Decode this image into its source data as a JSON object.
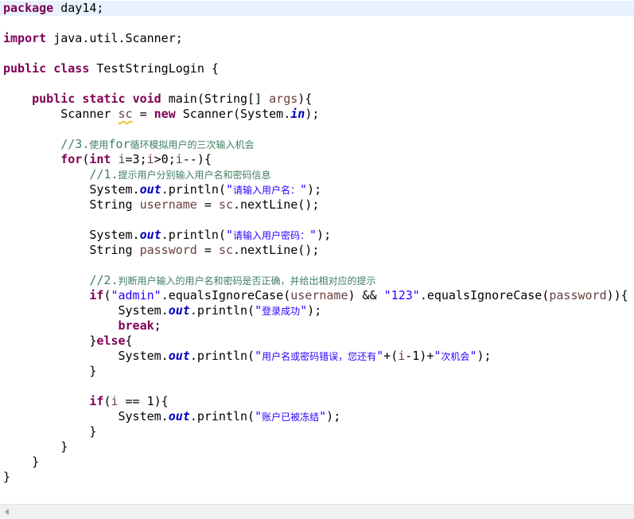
{
  "editor": {
    "lines": [
      {
        "tokens": [
          {
            "t": "package",
            "c": "kw"
          },
          {
            "t": " day14;"
          }
        ]
      },
      {
        "tokens": []
      },
      {
        "tokens": [
          {
            "t": "import",
            "c": "kw"
          },
          {
            "t": " java.util.Scanner;"
          }
        ]
      },
      {
        "tokens": []
      },
      {
        "tokens": [
          {
            "t": "public",
            "c": "kw"
          },
          {
            "t": " "
          },
          {
            "t": "class",
            "c": "kw"
          },
          {
            "t": " TestStringLogin {"
          }
        ]
      },
      {
        "tokens": []
      },
      {
        "tokens": [
          {
            "t": "    "
          },
          {
            "t": "public",
            "c": "kw"
          },
          {
            "t": " "
          },
          {
            "t": "static",
            "c": "kw"
          },
          {
            "t": " "
          },
          {
            "t": "void",
            "c": "kw"
          },
          {
            "t": " main(String[] "
          },
          {
            "t": "args",
            "c": "var"
          },
          {
            "t": "){"
          }
        ]
      },
      {
        "tokens": [
          {
            "t": "        Scanner "
          },
          {
            "t": "sc",
            "c": "var warn"
          },
          {
            "t": " = "
          },
          {
            "t": "new",
            "c": "kw"
          },
          {
            "t": " Scanner(System."
          },
          {
            "t": "in",
            "c": "fld"
          },
          {
            "t": ");"
          }
        ]
      },
      {
        "tokens": []
      },
      {
        "tokens": [
          {
            "t": "        "
          },
          {
            "t": "//3.",
            "c": "cm"
          },
          {
            "t": "使用",
            "c": "cm cjk"
          },
          {
            "t": "for",
            "c": "cm"
          },
          {
            "t": "循环模拟用户的三次输入机会",
            "c": "cm cjk"
          }
        ]
      },
      {
        "tokens": [
          {
            "t": "        "
          },
          {
            "t": "for",
            "c": "kw"
          },
          {
            "t": "("
          },
          {
            "t": "int",
            "c": "kw"
          },
          {
            "t": " "
          },
          {
            "t": "i",
            "c": "var"
          },
          {
            "t": "=3;"
          },
          {
            "t": "i",
            "c": "var"
          },
          {
            "t": ">0;"
          },
          {
            "t": "i",
            "c": "var"
          },
          {
            "t": "--){"
          }
        ]
      },
      {
        "tokens": [
          {
            "t": "            "
          },
          {
            "t": "//1.",
            "c": "cm"
          },
          {
            "t": "提示用户分别输入用户名和密码信息",
            "c": "cm cjk"
          }
        ]
      },
      {
        "tokens": [
          {
            "t": "            System."
          },
          {
            "t": "out",
            "c": "fld"
          },
          {
            "t": ".println("
          },
          {
            "t": "\"",
            "c": "str"
          },
          {
            "t": "请输入用户名：",
            "c": "str cjk"
          },
          {
            "t": "\"",
            "c": "str"
          },
          {
            "t": ");"
          }
        ]
      },
      {
        "tokens": [
          {
            "t": "            String "
          },
          {
            "t": "username",
            "c": "var"
          },
          {
            "t": " = "
          },
          {
            "t": "sc",
            "c": "var"
          },
          {
            "t": ".nextLine();"
          }
        ]
      },
      {
        "tokens": []
      },
      {
        "tokens": [
          {
            "t": "            System."
          },
          {
            "t": "out",
            "c": "fld"
          },
          {
            "t": ".println("
          },
          {
            "t": "\"",
            "c": "str"
          },
          {
            "t": "请输入用户密码：",
            "c": "str cjk"
          },
          {
            "t": "\"",
            "c": "str"
          },
          {
            "t": ");"
          }
        ]
      },
      {
        "tokens": [
          {
            "t": "            String "
          },
          {
            "t": "password",
            "c": "var"
          },
          {
            "t": " = "
          },
          {
            "t": "sc",
            "c": "var"
          },
          {
            "t": ".nextLine();"
          }
        ]
      },
      {
        "tokens": []
      },
      {
        "tokens": [
          {
            "t": "            "
          },
          {
            "t": "//2.",
            "c": "cm"
          },
          {
            "t": "判断用户输入的用户名和密码是否正确，并给出相对应的提示",
            "c": "cm cjk"
          }
        ]
      },
      {
        "tokens": [
          {
            "t": "            "
          },
          {
            "t": "if",
            "c": "kw"
          },
          {
            "t": "("
          },
          {
            "t": "\"admin\"",
            "c": "str"
          },
          {
            "t": ".equalsIgnoreCase("
          },
          {
            "t": "username",
            "c": "var"
          },
          {
            "t": ") && "
          },
          {
            "t": "\"123\"",
            "c": "str"
          },
          {
            "t": ".equalsIgnoreCase("
          },
          {
            "t": "password",
            "c": "var"
          },
          {
            "t": ")){"
          }
        ]
      },
      {
        "tokens": [
          {
            "t": "                System."
          },
          {
            "t": "out",
            "c": "fld"
          },
          {
            "t": ".println("
          },
          {
            "t": "\"",
            "c": "str"
          },
          {
            "t": "登录成功",
            "c": "str cjk"
          },
          {
            "t": "\"",
            "c": "str"
          },
          {
            "t": ");"
          }
        ]
      },
      {
        "tokens": [
          {
            "t": "                "
          },
          {
            "t": "break",
            "c": "kw"
          },
          {
            "t": ";"
          }
        ]
      },
      {
        "tokens": [
          {
            "t": "            }"
          },
          {
            "t": "else",
            "c": "kw"
          },
          {
            "t": "{"
          }
        ]
      },
      {
        "tokens": [
          {
            "t": "                System."
          },
          {
            "t": "out",
            "c": "fld"
          },
          {
            "t": ".println("
          },
          {
            "t": "\"",
            "c": "str"
          },
          {
            "t": "用户名或密码错误，您还有",
            "c": "str cjk"
          },
          {
            "t": "\"",
            "c": "str"
          },
          {
            "t": "+("
          },
          {
            "t": "i",
            "c": "var"
          },
          {
            "t": "-1)+"
          },
          {
            "t": "\"",
            "c": "str"
          },
          {
            "t": "次机会",
            "c": "str cjk"
          },
          {
            "t": "\"",
            "c": "str"
          },
          {
            "t": ");"
          }
        ]
      },
      {
        "tokens": [
          {
            "t": "            }"
          }
        ]
      },
      {
        "tokens": []
      },
      {
        "tokens": [
          {
            "t": "            "
          },
          {
            "t": "if",
            "c": "kw"
          },
          {
            "t": "("
          },
          {
            "t": "i",
            "c": "var"
          },
          {
            "t": " == 1){"
          }
        ]
      },
      {
        "tokens": [
          {
            "t": "                System."
          },
          {
            "t": "out",
            "c": "fld"
          },
          {
            "t": ".println("
          },
          {
            "t": "\"",
            "c": "str"
          },
          {
            "t": "账户已被冻结",
            "c": "str cjk"
          },
          {
            "t": "\"",
            "c": "str"
          },
          {
            "t": ");"
          }
        ]
      },
      {
        "tokens": [
          {
            "t": "            }"
          }
        ]
      },
      {
        "tokens": [
          {
            "t": "        }"
          }
        ]
      },
      {
        "tokens": [
          {
            "t": "    }"
          }
        ]
      },
      {
        "tokens": [
          {
            "t": "}"
          }
        ]
      }
    ]
  }
}
